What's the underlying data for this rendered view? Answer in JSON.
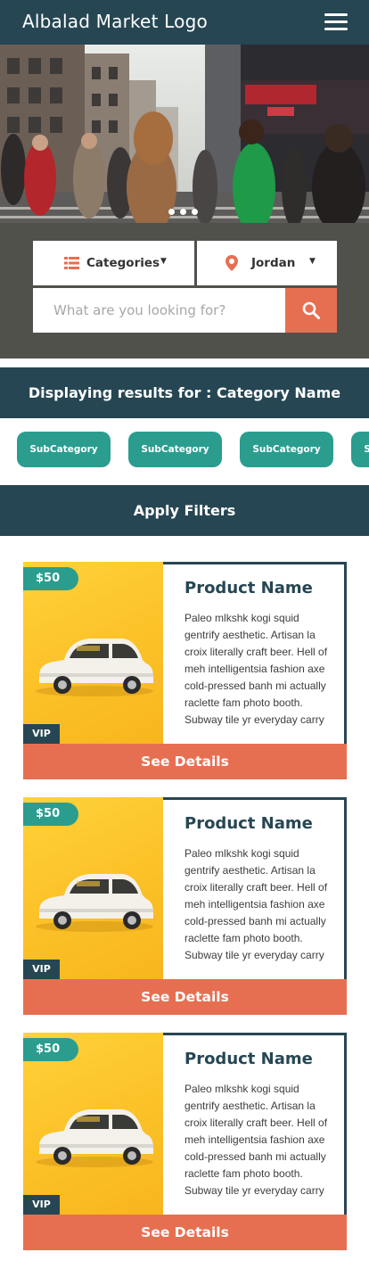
{
  "header": {
    "brand": "Albalad Market Logo",
    "menu_icon": "hamburger-menu-icon"
  },
  "hero": {
    "slides_count": 3,
    "active_slide": 1
  },
  "search": {
    "category_label": "Categories",
    "category_icon": "list-icon",
    "location_label": "Jordan",
    "location_icon": "map-pin-icon",
    "placeholder": "What are you looking for?",
    "button_icon": "search-icon"
  },
  "results": {
    "text": "Displaying results for : Category Name"
  },
  "subcategories": [
    "SubCategory",
    "SubCategory",
    "SubCategory",
    "SubCategory"
  ],
  "filters": {
    "label": "Apply Filters"
  },
  "products": [
    {
      "price": "$50",
      "badge": "VIP",
      "name": "Product Name",
      "description": "Paleo mlkshk kogi squid gentrify aesthetic. Artisan la croix literally craft beer. Hell of meh intelligentsia fashion axe cold-pressed banh mi actually raclette fam photo booth. Subway tile yr everyday carry",
      "button": "See Details"
    },
    {
      "price": "$50",
      "badge": "VIP",
      "name": "Product Name",
      "description": "Paleo mlkshk kogi squid gentrify aesthetic. Artisan la croix literally craft beer. Hell of meh intelligentsia fashion axe cold-pressed banh mi actually raclette fam photo booth. Subway tile yr everyday carry",
      "button": "See Details"
    },
    {
      "price": "$50",
      "badge": "VIP",
      "name": "Product Name",
      "description": "Paleo mlkshk kogi squid gentrify aesthetic. Artisan la croix literally craft beer. Hell of meh intelligentsia fashion axe cold-pressed banh mi actually raclette fam photo booth. Subway tile yr everyday carry",
      "button": "See Details"
    }
  ],
  "colors": {
    "primary": "#264653",
    "teal": "#2a9d8f",
    "accent": "#e76f51",
    "yellow": "#fcc42a",
    "panel": "#51514c"
  }
}
